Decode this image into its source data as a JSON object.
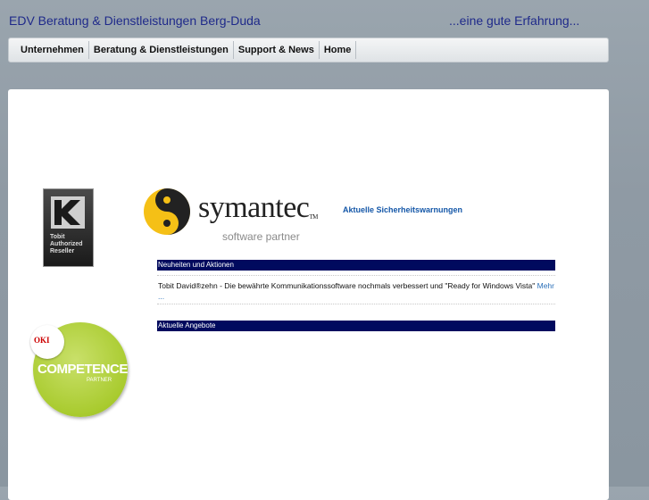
{
  "header": {
    "title": "EDV Beratung & Dienstleistungen Berg-Duda",
    "tagline": "...eine gute Erfahrung..."
  },
  "nav": {
    "items": [
      "Unternehmen",
      "Beratung & Dienstleistungen",
      "Support & News",
      "Home"
    ]
  },
  "logos": {
    "tobit_text": "Tobit Authorized Reseller",
    "oki_brand": "OKI",
    "oki_competence": "COMPETENCE",
    "oki_partner": "PARTNER",
    "symantec_word": "symantec",
    "symantec_tm": "TM",
    "symantec_sub": "software partner"
  },
  "content": {
    "security_link": "Aktuelle Sicherheitswarnungen",
    "news_header": "Neuheiten und Aktionen",
    "news_text": "Tobit David®zehn - Die bewährte Kommunikationssoftware nochmals verbessert und \"Ready for Windows Vista\"",
    "news_more": "Mehr ...",
    "offers_header": "Aktuelle Angebote"
  },
  "colors": {
    "brand_title": "#1f2a8a",
    "section_bar": "#000a5e",
    "link": "#1457a8"
  }
}
